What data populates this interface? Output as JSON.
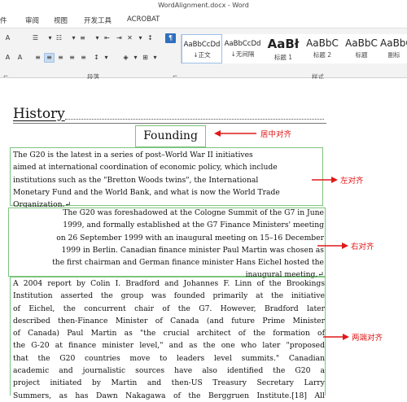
{
  "window": {
    "title": "WordAlignment.docx - Word"
  },
  "menu": [
    "件",
    "审阅",
    "视图",
    "开发工具",
    "ACROBAT"
  ],
  "ribbon": {
    "group_labels": {
      "paragraph": "段落",
      "styles": "样式"
    },
    "styles": [
      {
        "sample": "AaBbCcDd",
        "name": "↓正文"
      },
      {
        "sample": "AaBbCcDd",
        "name": "↓无间隔"
      },
      {
        "sample": "AaBł",
        "name": "标题 1"
      },
      {
        "sample": "AaBbC",
        "name": "标题 2"
      },
      {
        "sample": "AaBbC",
        "name": "标题"
      },
      {
        "sample": "AaBbC",
        "name": "副标"
      }
    ]
  },
  "document": {
    "heading": "History",
    "founding": "Founding",
    "para1": [
      "The G20 is the latest in a series of post–World War II initiatives",
      "aimed at international coordination of economic policy, which include",
      "institutions such as the \"Bretton Woods twins\", the International",
      "Monetary Fund and the World Bank, and what is now the World Trade",
      "Organization.↵"
    ],
    "para2": [
      "The G20 was foreshadowed at the Cologne Summit of the G7 in June",
      "1999, and formally established at the G7 Finance Ministers' meeting",
      "on 26 September 1999 with an inaugural meeting on 15–16 December",
      "1999 in Berlin. Canadian finance minister Paul Martin was chosen as",
      "the first chairman and German finance minister Hans Eichel hosted the",
      "inaugural meeting.↵"
    ],
    "para3": [
      "A 2004 report by Colin I. Bradford and Johannes F. Linn of the Brookings",
      "Institution asserted the group was founded primarily at the initiative",
      "of Eichel, the concurrent chair of the G7. However, Bradford later",
      "described then-Finance Minister of Canada (and future Prime Minister",
      "of Canada) Paul Martin as \"the crucial architect of the formation of",
      "the G-20 at finance minister level,\" and as the one who later \"proposed",
      "that the G20 countries move to leaders level summits.\" Canadian",
      "academic and journalistic sources have also identified the G20 a",
      "project initiated by Martin and then-US Treasury Secretary Larry",
      "Summers, as has Dawn Nakagawa of the Berggruen Institute.[18] All"
    ]
  },
  "annotations": {
    "center": "居中对齐",
    "left": "左对齐",
    "right": "右对齐",
    "justify": "两端对齐"
  },
  "colors": {
    "annotation": "#e01818",
    "box": "#7dc47d",
    "accent": "#2f6fbf"
  }
}
